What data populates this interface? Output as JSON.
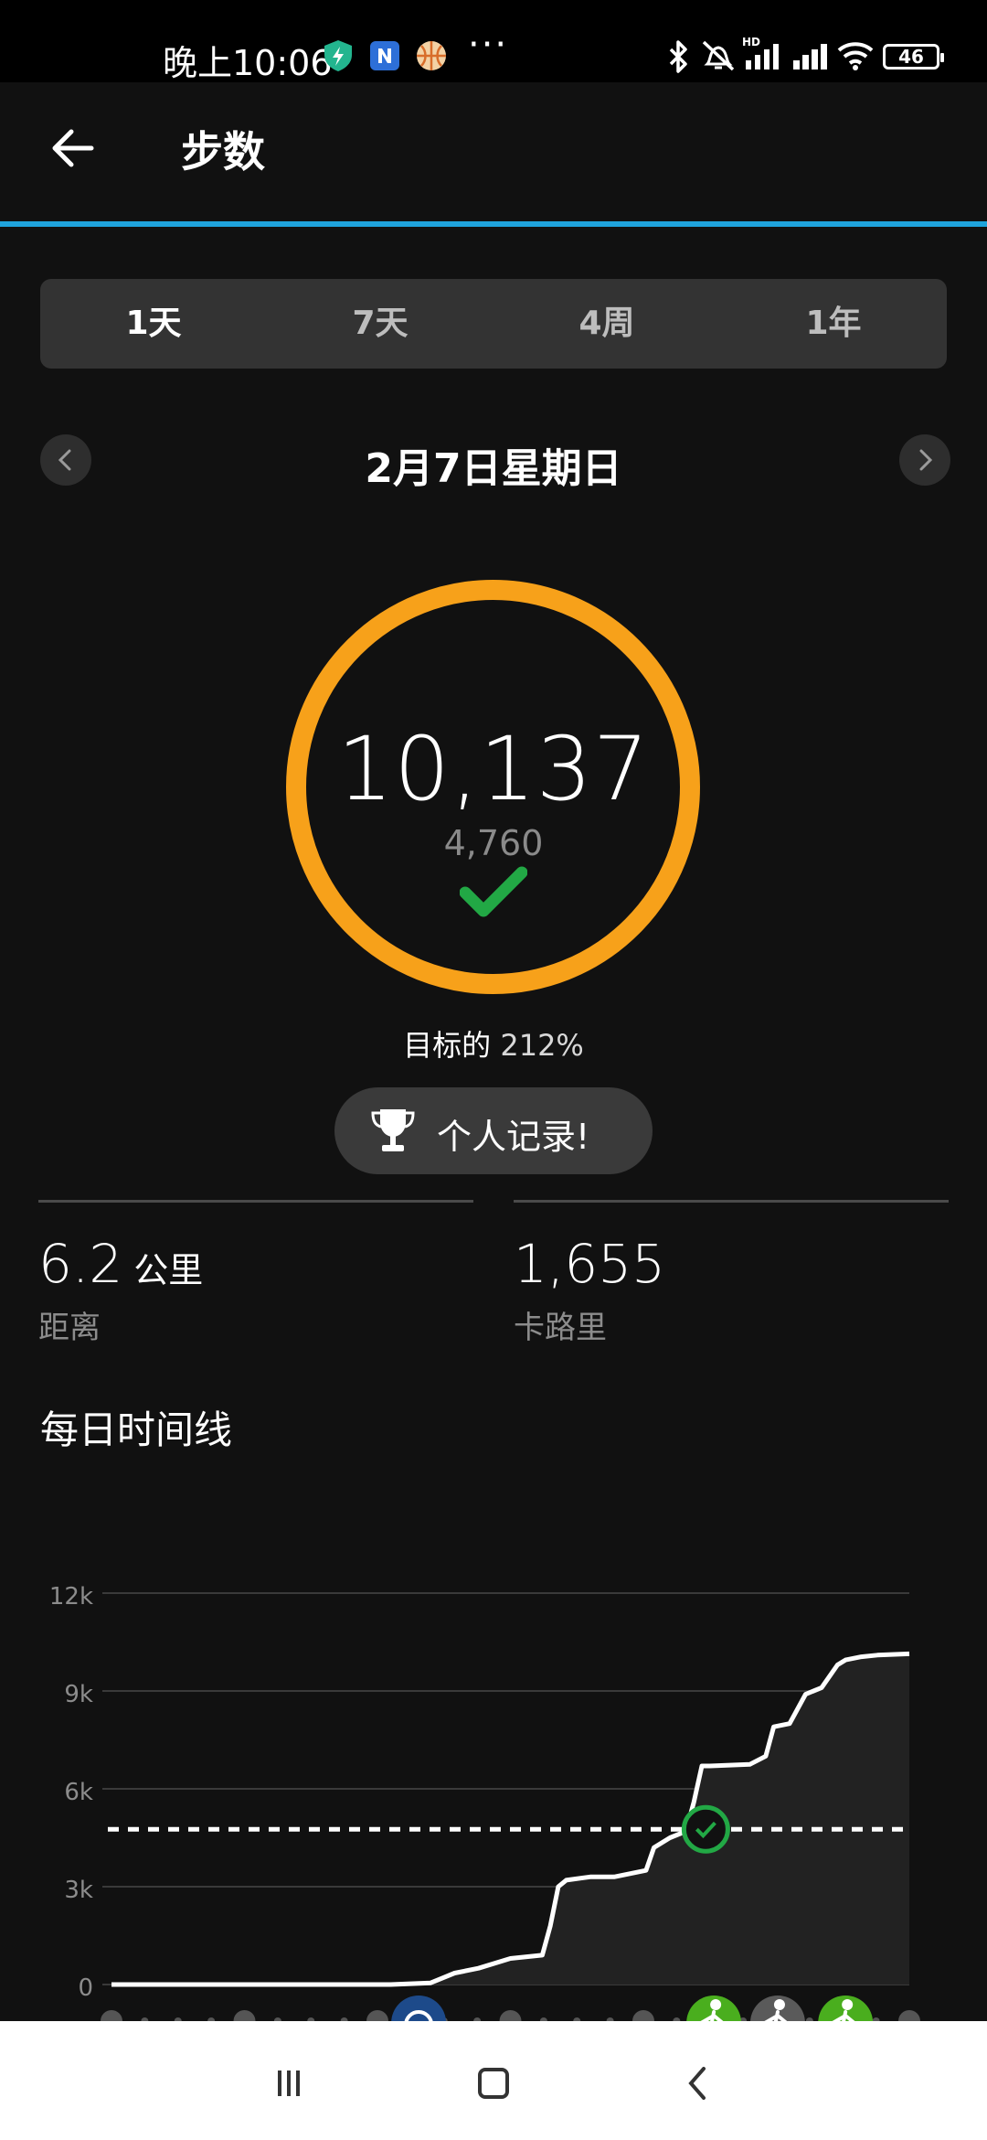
{
  "status_bar": {
    "time": "晚上10:06",
    "battery_level": "46",
    "icons": [
      "shield-bolt-icon",
      "n-app-icon",
      "basketball-icon",
      "more-dots-icon",
      "bluetooth-icon",
      "no-alarm-icon",
      "hd-signal-icon",
      "signal-icon",
      "wifi-icon",
      "battery-icon"
    ],
    "more": "···"
  },
  "header": {
    "title": "步数",
    "accent_color": "#1fa3dc"
  },
  "tabs": [
    {
      "label": "1天",
      "active": true
    },
    {
      "label": "7天",
      "active": false
    },
    {
      "label": "4周",
      "active": false
    },
    {
      "label": "1年",
      "active": false
    }
  ],
  "date_nav": {
    "label": "2月7日星期日"
  },
  "summary": {
    "steps": "10,137",
    "goal": "4,760",
    "goal_prefix": "目标的",
    "goal_percent": "212%",
    "ring_color": "#f7a11a",
    "check_color": "#22a845"
  },
  "record": {
    "label": "个人记录!"
  },
  "stats": {
    "distance_value": "6.2",
    "distance_unit": "公里",
    "distance_label": "距离",
    "calories_value": "1,655",
    "calories_label": "卡路里"
  },
  "timeline": {
    "title": "每日时间线"
  },
  "chart_data": {
    "type": "area",
    "ylabels": [
      "12k",
      "9k",
      "6k",
      "3k",
      "0"
    ],
    "ylim": [
      0,
      12000
    ],
    "goal_line": 4760,
    "x": [
      0,
      0.35,
      0.4,
      0.43,
      0.46,
      0.5,
      0.54,
      0.55,
      0.56,
      0.57,
      0.6,
      0.63,
      0.67,
      0.68,
      0.7,
      0.72,
      0.73,
      0.74,
      0.75,
      0.8,
      0.82,
      0.83,
      0.85,
      0.87,
      0.89,
      0.91,
      0.92,
      0.94,
      0.96,
      1.0
    ],
    "y": [
      0,
      0,
      50,
      350,
      500,
      800,
      900,
      1800,
      3000,
      3200,
      3300,
      3300,
      3500,
      4200,
      4500,
      4700,
      5600,
      6700,
      6700,
      6750,
      7000,
      7900,
      8000,
      8900,
      9100,
      9800,
      9950,
      10050,
      10100,
      10137
    ],
    "goal_marker_x": 0.745,
    "activity_markers": [
      {
        "x": 0.385,
        "icon": "alarm-icon"
      },
      {
        "x": 0.755,
        "icon": "run-icon"
      },
      {
        "x": 0.835,
        "icon": "walk-icon"
      },
      {
        "x": 0.92,
        "icon": "run-icon"
      }
    ],
    "grid": true
  },
  "bottom_nav": [
    "recents-icon",
    "home-icon",
    "back-icon"
  ]
}
